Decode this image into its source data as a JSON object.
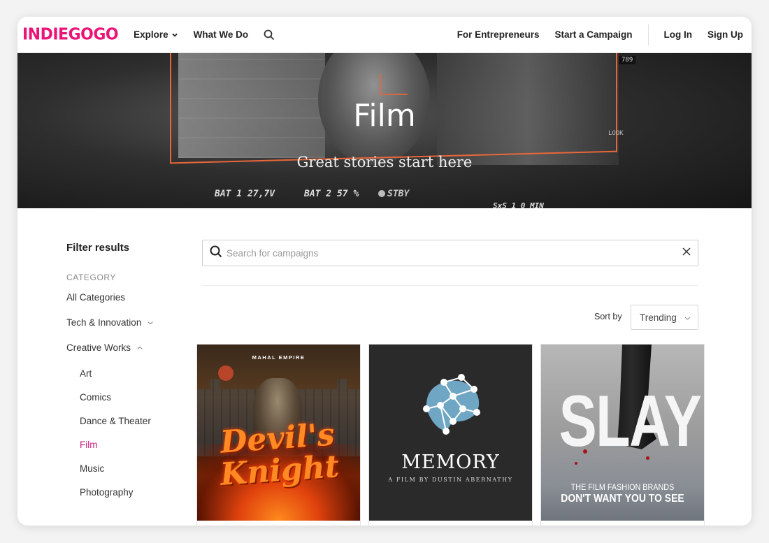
{
  "brand": {
    "logo_text": "INDIEGOGO",
    "accent": "#eb1478",
    "active_color": "#c8217e"
  },
  "nav": {
    "explore": "Explore",
    "what_we_do": "What We Do",
    "for_entrepreneurs": "For Entrepreneurs",
    "start_campaign": "Start a Campaign",
    "log_in": "Log In",
    "sign_up": "Sign Up"
  },
  "hero": {
    "title": "Film",
    "subtitle": "Great stories start here",
    "hud": [
      "BAT 1 27,7V",
      "BAT 2 57 %",
      "STBY",
      "SxS 1 0 MIN"
    ],
    "counter": "789",
    "look": "LOOK"
  },
  "sidebar": {
    "filter_title": "Filter results",
    "category_label": "CATEGORY",
    "items": [
      {
        "label": "All Categories"
      },
      {
        "label": "Tech & Innovation"
      },
      {
        "label": "Creative Works"
      }
    ],
    "sub_items": [
      {
        "label": "Art"
      },
      {
        "label": "Comics"
      },
      {
        "label": "Dance & Theater"
      },
      {
        "label": "Film"
      },
      {
        "label": "Music"
      },
      {
        "label": "Photography"
      }
    ]
  },
  "search": {
    "placeholder": "Search for campaigns",
    "value": ""
  },
  "sort": {
    "label": "Sort by",
    "selected": "Trending"
  },
  "cards": [
    {
      "studio": "MAHAL EMPIRE",
      "title_line1": "Devil's",
      "title_line2": "Knight"
    },
    {
      "title": "MEMORY",
      "subtitle": "A FILM BY DUSTIN ABERNATHY"
    },
    {
      "title": "SLAY",
      "subtitle_line1": "THE FILM FASHION BRANDS",
      "subtitle_line2": "DON'T WANT YOU TO SEE"
    }
  ]
}
